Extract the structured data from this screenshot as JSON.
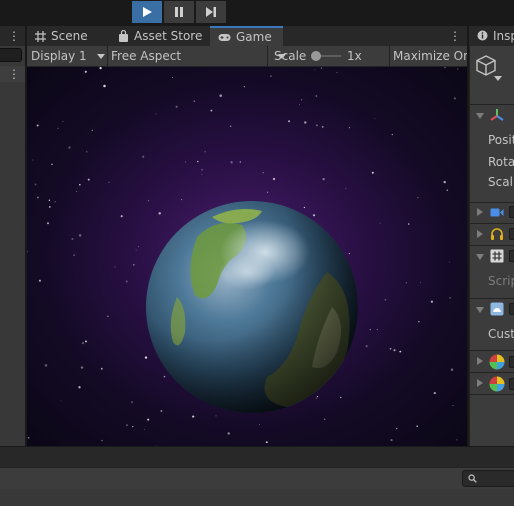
{
  "toolbar": {
    "play_icon": "play-icon",
    "pause_icon": "pause-icon",
    "step_icon": "step-icon",
    "play_active_color": "#3a6fa5"
  },
  "tabs": [
    {
      "label": "Scene",
      "icon": "grid-hash-icon"
    },
    {
      "label": "Asset Store",
      "icon": "shopping-bag-icon"
    },
    {
      "label": "Game",
      "icon": "gamepad-icon",
      "active": true
    }
  ],
  "game_toolbar": {
    "display": "Display 1",
    "aspect": "Free Aspect",
    "scale_label": "Scale",
    "scale_value": 0.1,
    "scale_text": "1x",
    "maximize_label": "Maximize On"
  },
  "inspector": {
    "tab_label": "Insp",
    "object_icon": "cube-icon",
    "transform_labels": [
      "Posit",
      "Rota",
      "Scal"
    ],
    "script_label": "Scrip",
    "cust_label": "Cust",
    "component_icons": [
      "transform-axes-icon",
      "camera-icon",
      "audio-listener-icon",
      "script-hash-icon",
      "skybox-icon",
      "material-sphere-icon",
      "material-sphere-icon"
    ]
  }
}
